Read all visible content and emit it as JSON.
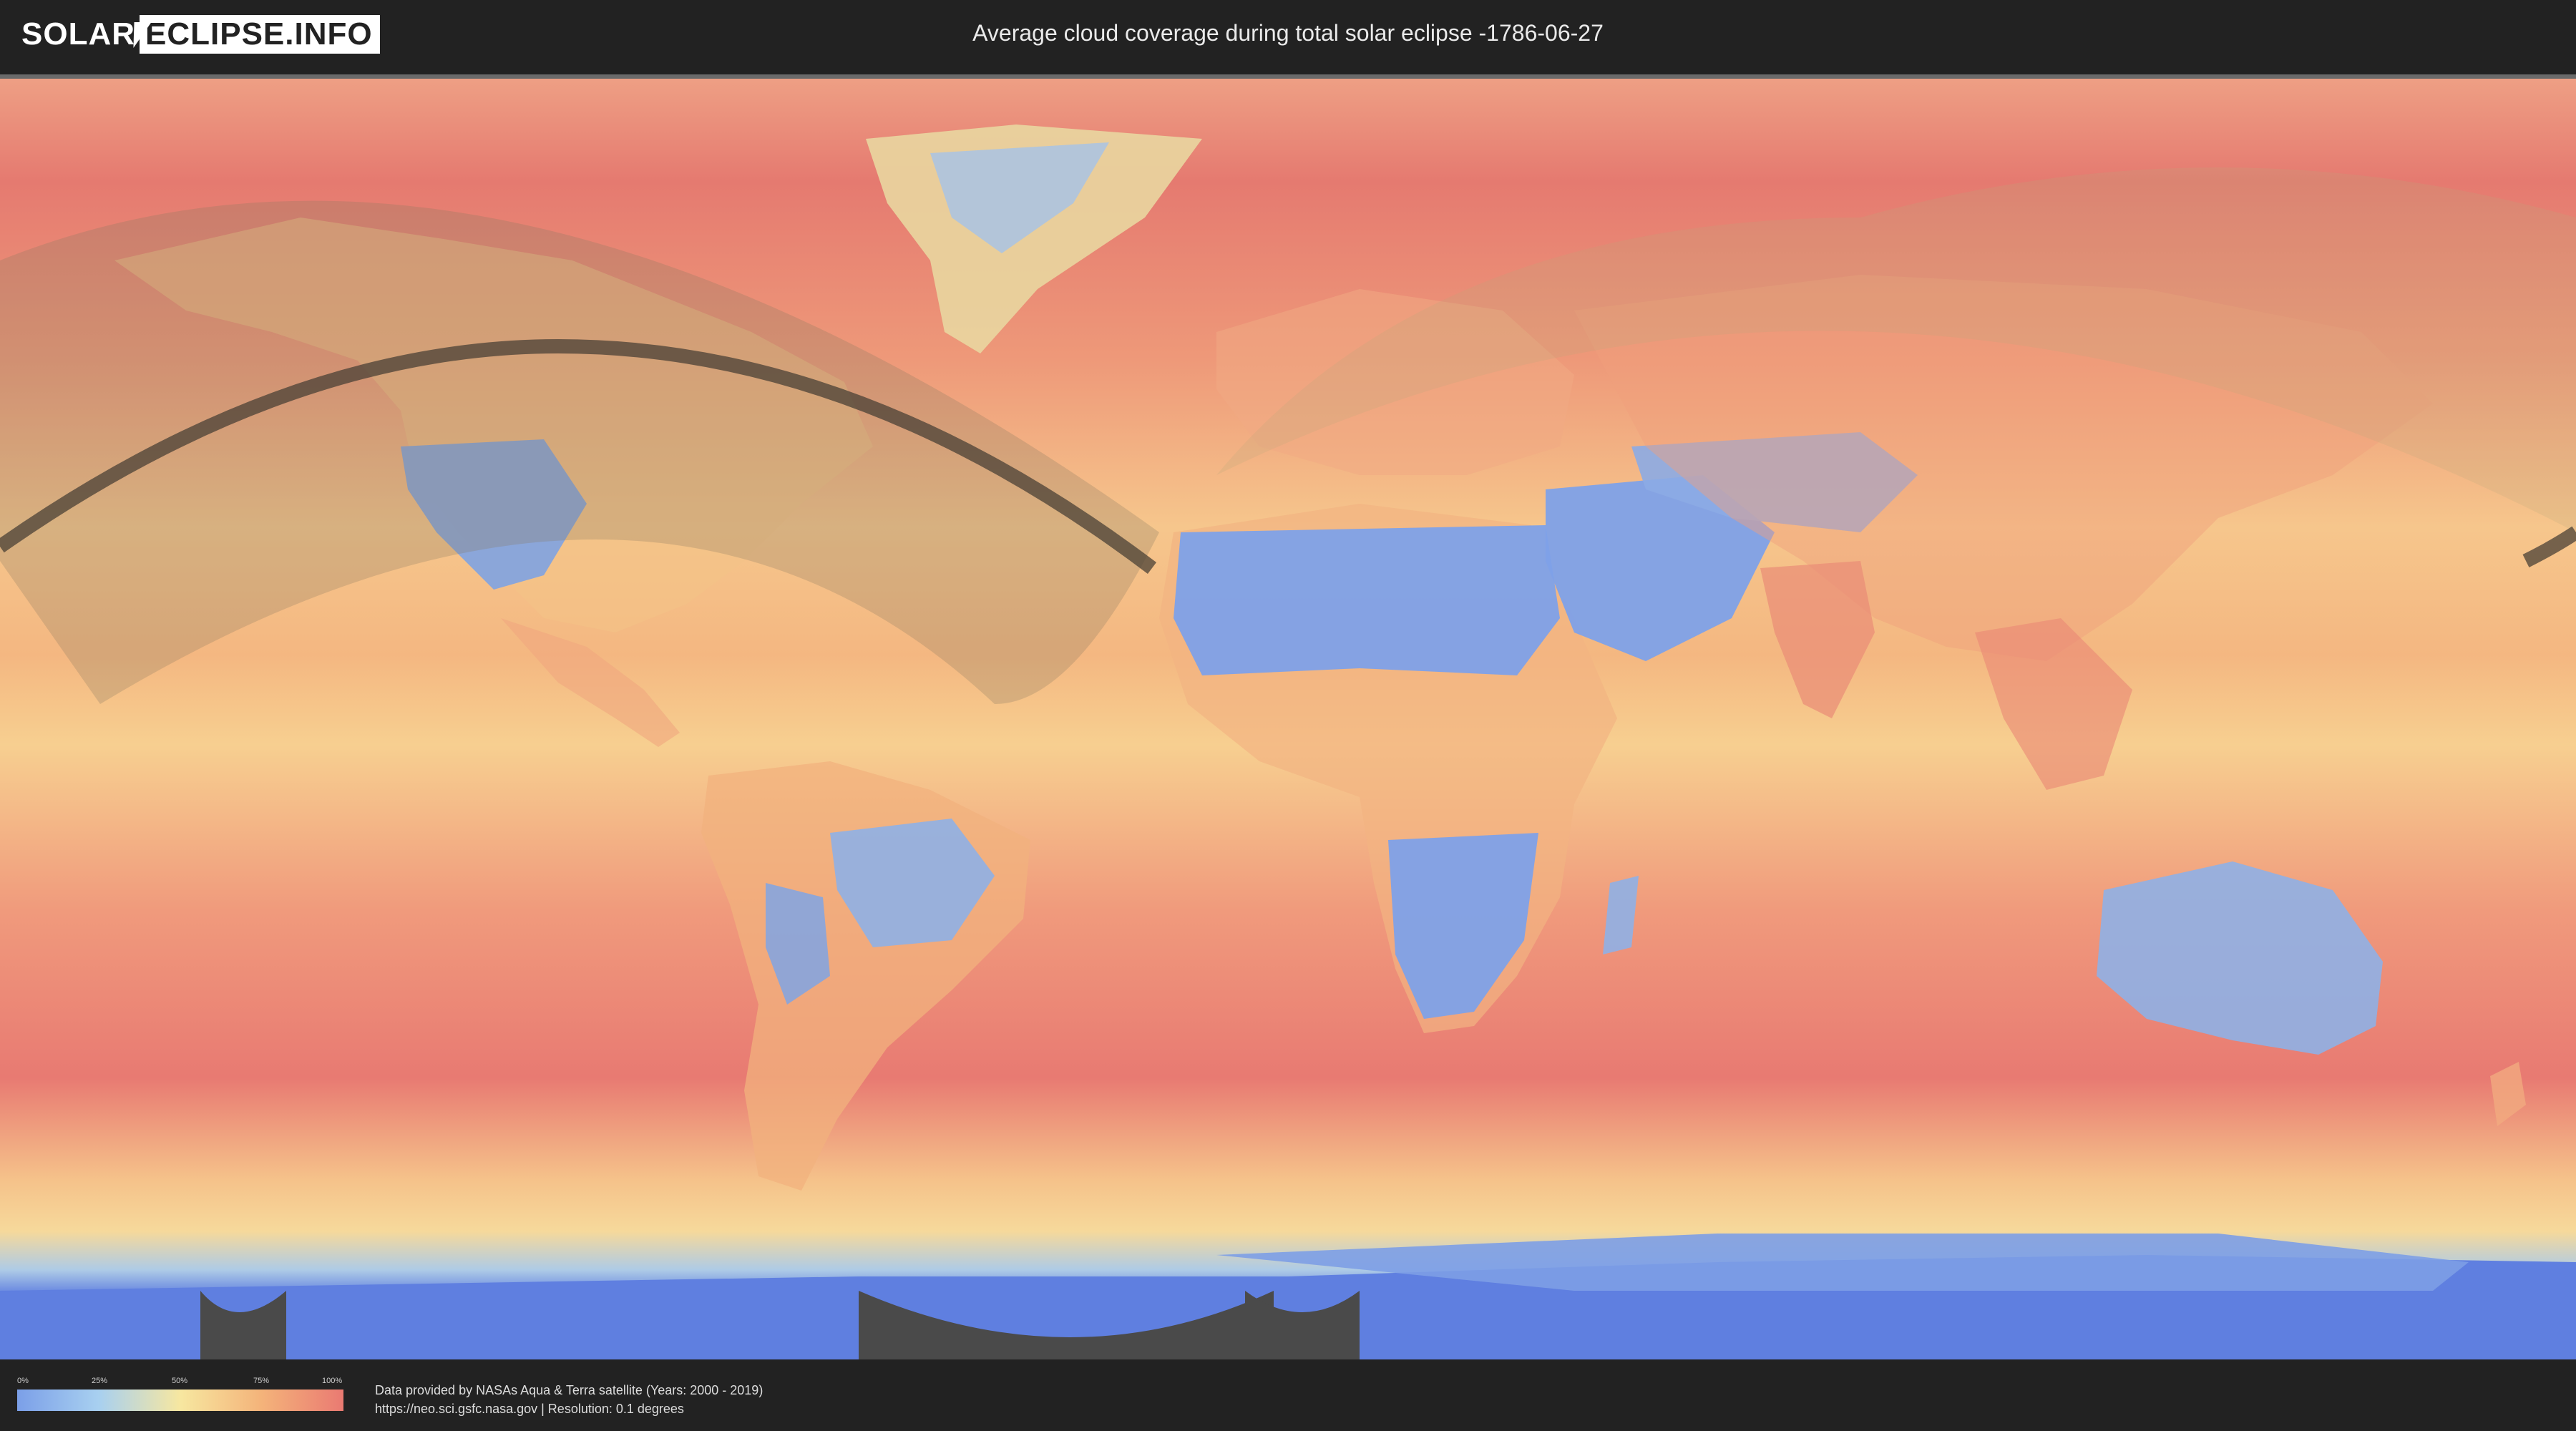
{
  "header": {
    "logo_left": "SOLAR",
    "logo_right": "ECLIPSE.INFO",
    "title": "Average cloud coverage during total solar eclipse -1786-06-27"
  },
  "legend": {
    "ticks": [
      "0%",
      "25%",
      "50%",
      "75%",
      "100%"
    ],
    "colors": [
      "#7b9fe8",
      "#a8d0f0",
      "#f7e7a0",
      "#f4b37a",
      "#ea7a72"
    ]
  },
  "footer": {
    "credit_line1": "Data provided by NASAs Aqua & Terra satellite (Years: 2000 - 2019)",
    "credit_line2": "https://neo.sci.gsfc.nasa.gov | Resolution: 0.1 degrees"
  }
}
